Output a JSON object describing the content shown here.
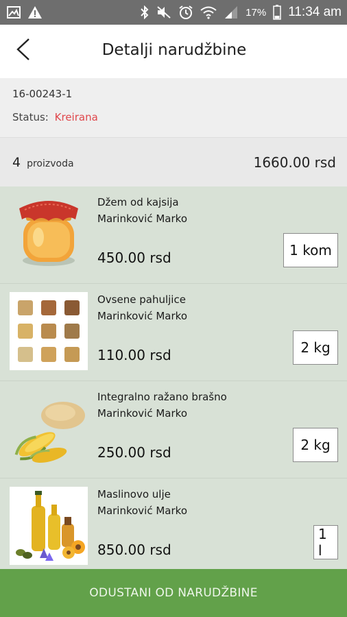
{
  "status_bar": {
    "battery": "17%",
    "time": "11:34 am",
    "icons_left": [
      "gallery-icon",
      "warning-icon"
    ],
    "icons_right": [
      "bluetooth-icon",
      "mute-icon",
      "alarm-icon",
      "wifi-icon",
      "signal-icon",
      "battery-icon"
    ]
  },
  "header": {
    "title": "Detalji narudžbine",
    "back_icon": "chevron-left-icon"
  },
  "order": {
    "id": "16-00243-1",
    "status_label": "Status:",
    "status_value": "Kreirana"
  },
  "summary": {
    "count": "4",
    "count_label": "proizvoda",
    "total": "1660.00 rsd"
  },
  "products": [
    {
      "name": "Džem od kajsija",
      "seller": "Marinković Marko",
      "price": "450.00 rsd",
      "quantity": "1 kom",
      "image": "jam-jar-image"
    },
    {
      "name": "Ovsene pahuljice",
      "seller": "Marinković Marko",
      "price": "110.00 rsd",
      "quantity": "2 kg",
      "image": "grains-image"
    },
    {
      "name": "Integralno ražano brašno",
      "seller": "Marinković Marko",
      "price": "250.00 rsd",
      "quantity": "2 kg",
      "image": "corn-flour-image"
    },
    {
      "name": "Maslinovo ulje",
      "seller": "Marinković Marko",
      "price": "850.00 rsd",
      "quantity": "1 l",
      "image": "oil-bottles-image"
    }
  ],
  "cancel_button": "ODUSTANI OD NARUDŽBINE",
  "colors": {
    "status_bar": "#6e6e6e",
    "status_value": "#e0474c",
    "list_background": "#d8e1d6",
    "cancel_button": "#62a14a"
  }
}
